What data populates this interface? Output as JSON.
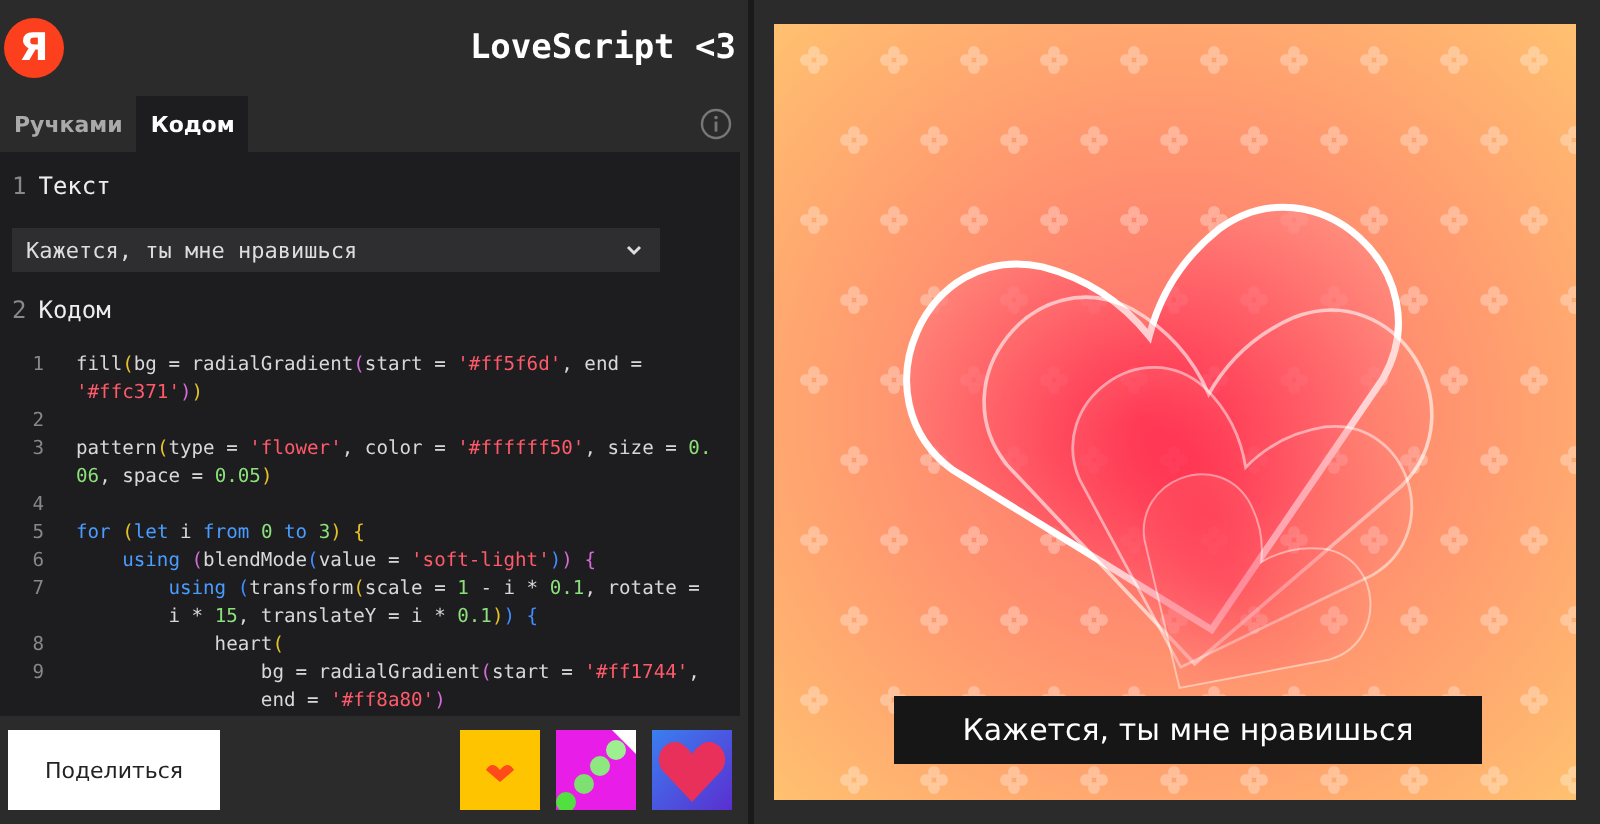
{
  "header": {
    "logo": "Я",
    "title": "LoveScript <3"
  },
  "tabs": [
    {
      "label": "Ручками",
      "selected": false
    },
    {
      "label": "Кодом",
      "selected": true
    }
  ],
  "sections": [
    {
      "number": "1",
      "title": "Текст"
    },
    {
      "number": "2",
      "title": "Кодом"
    }
  ],
  "text_select": {
    "value": "Кажется, ты мне нравишься"
  },
  "code_rows": [
    {
      "number": "1",
      "tokens": [
        {
          "kind": "plain",
          "text": "fill"
        },
        {
          "kind": "bracket1",
          "text": "("
        },
        {
          "kind": "plain",
          "text": "bg = radialGradient"
        },
        {
          "kind": "bracket2",
          "text": "("
        },
        {
          "kind": "plain",
          "text": "start = "
        },
        {
          "kind": "string",
          "text": "'#ff5f6d'"
        },
        {
          "kind": "plain",
          "text": ", end ="
        }
      ]
    },
    {
      "tokens": [
        {
          "kind": "string",
          "text": "'#ffc371'"
        },
        {
          "kind": "bracket2",
          "text": ")"
        },
        {
          "kind": "bracket1",
          "text": ")"
        }
      ]
    },
    {
      "number": "2",
      "tokens": []
    },
    {
      "number": "3",
      "tokens": [
        {
          "kind": "plain",
          "text": "pattern"
        },
        {
          "kind": "bracket1",
          "text": "("
        },
        {
          "kind": "plain",
          "text": "type = "
        },
        {
          "kind": "string",
          "text": "'flower'"
        },
        {
          "kind": "plain",
          "text": ", color = "
        },
        {
          "kind": "string",
          "text": "'#ffffff50'"
        },
        {
          "kind": "plain",
          "text": ", size = "
        },
        {
          "kind": "number",
          "text": "0."
        }
      ]
    },
    {
      "tokens": [
        {
          "kind": "number",
          "text": "06"
        },
        {
          "kind": "plain",
          "text": ", space = "
        },
        {
          "kind": "number",
          "text": "0.05"
        },
        {
          "kind": "bracket1",
          "text": ")"
        }
      ]
    },
    {
      "number": "4",
      "tokens": []
    },
    {
      "number": "5",
      "tokens": [
        {
          "kind": "keyword",
          "text": "for "
        },
        {
          "kind": "bracket1",
          "text": "("
        },
        {
          "kind": "keyword",
          "text": "let"
        },
        {
          "kind": "plain",
          "text": " i "
        },
        {
          "kind": "keyword",
          "text": "from "
        },
        {
          "kind": "number",
          "text": "0 "
        },
        {
          "kind": "keyword",
          "text": "to "
        },
        {
          "kind": "number",
          "text": "3"
        },
        {
          "kind": "bracket1",
          "text": ") "
        },
        {
          "kind": "bracket1",
          "text": "{"
        }
      ]
    },
    {
      "number": "6",
      "tokens": [
        {
          "kind": "keyword",
          "text": "    using "
        },
        {
          "kind": "bracket2",
          "text": "("
        },
        {
          "kind": "plain",
          "text": "blendMode"
        },
        {
          "kind": "bracket3",
          "text": "("
        },
        {
          "kind": "plain",
          "text": "value = "
        },
        {
          "kind": "string",
          "text": "'soft-light'"
        },
        {
          "kind": "bracket3",
          "text": ")"
        },
        {
          "kind": "bracket2",
          "text": ") "
        },
        {
          "kind": "bracket2",
          "text": "{"
        }
      ]
    },
    {
      "number": "7",
      "tokens": [
        {
          "kind": "keyword",
          "text": "        using "
        },
        {
          "kind": "bracket3",
          "text": "("
        },
        {
          "kind": "plain",
          "text": "transform"
        },
        {
          "kind": "bracket1",
          "text": "("
        },
        {
          "kind": "plain",
          "text": "scale = "
        },
        {
          "kind": "number",
          "text": "1"
        },
        {
          "kind": "plain",
          "text": " - i * "
        },
        {
          "kind": "number",
          "text": "0.1"
        },
        {
          "kind": "plain",
          "text": ", rotate ="
        }
      ]
    },
    {
      "tokens": [
        {
          "kind": "plain",
          "text": "        i * "
        },
        {
          "kind": "number",
          "text": "15"
        },
        {
          "kind": "plain",
          "text": ", translateY = i * "
        },
        {
          "kind": "number",
          "text": "0.1"
        },
        {
          "kind": "bracket1",
          "text": ")"
        },
        {
          "kind": "bracket3",
          "text": ") "
        },
        {
          "kind": "bracket3",
          "text": "{"
        }
      ]
    },
    {
      "number": "8",
      "tokens": [
        {
          "kind": "plain",
          "text": "            heart"
        },
        {
          "kind": "bracket1",
          "text": "("
        }
      ]
    },
    {
      "number": "9",
      "tokens": [
        {
          "kind": "plain",
          "text": "                bg = radialGradient"
        },
        {
          "kind": "bracket2",
          "text": "("
        },
        {
          "kind": "plain",
          "text": "start = "
        },
        {
          "kind": "string",
          "text": "'#ff1744'"
        },
        {
          "kind": "plain",
          "text": ","
        }
      ]
    },
    {
      "tokens": [
        {
          "kind": "plain",
          "text": "                end = "
        },
        {
          "kind": "string",
          "text": "'#ff8a80'"
        },
        {
          "kind": "bracket2",
          "text": ")"
        }
      ]
    }
  ],
  "share_button": "Поделиться",
  "preview": {
    "caption": "Кажется, ты мне нравишься"
  }
}
